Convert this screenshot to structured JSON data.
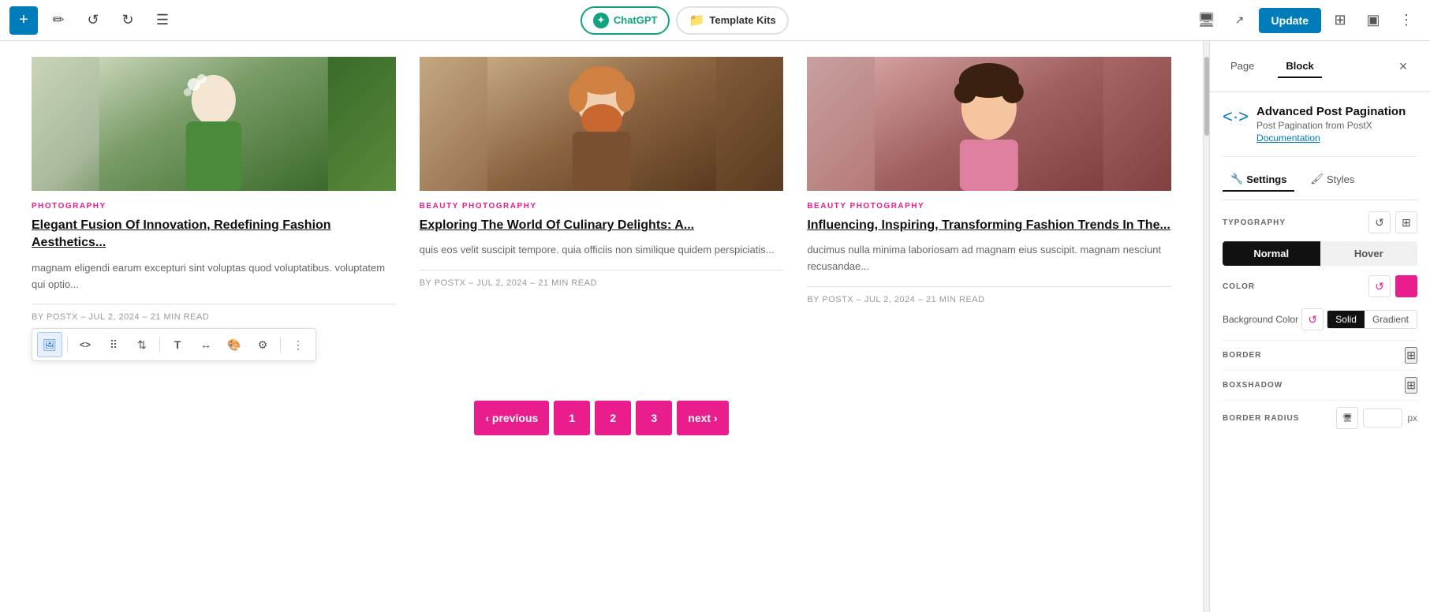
{
  "topbar": {
    "add_label": "+",
    "chatgpt_label": "ChatGPT",
    "template_kits_label": "Template Kits",
    "update_label": "Update"
  },
  "sidebar": {
    "page_tab": "Page",
    "block_tab": "Block",
    "close_label": "×",
    "block_info": {
      "title": "Advanced Post Pagination",
      "subtitle": "Post Pagination from PostX",
      "docs_link": "Documentation"
    },
    "settings_tab": "Settings",
    "styles_tab": "Styles",
    "typography_label": "TYPOGRAPHY",
    "normal_label": "Normal",
    "hover_label": "Hover",
    "color_label": "COLOR",
    "background_color_label": "Background Color",
    "solid_label": "Solid",
    "gradient_label": "Gradient",
    "border_label": "BORDER",
    "boxshadow_label": "BOXSHADOW",
    "border_radius_label": "BORDER RADIUS",
    "px_label": "px"
  },
  "cards": [
    {
      "category": "PHOTOGRAPHY",
      "title": "Elegant Fusion Of Innovation, Redefining Fashion Aesthetics...",
      "excerpt": "magnam eligendi earum excepturi sint voluptas quod voluptatibus. voluptatem qui optio...",
      "meta": "BY POSTX  –  JUL 2, 2024  –  21 MIN READ",
      "image_type": "woman"
    },
    {
      "category": "BEAUTY  PHOTOGRAPHY",
      "title": "Exploring The World Of Culinary Delights: A...",
      "excerpt": "quis eos velit suscipit tempore. quia officiis non similique quidem perspiciatis...",
      "meta": "BY POSTX  –  JUL 2, 2024  –  21 MIN READ",
      "image_type": "man"
    },
    {
      "category": "BEAUTY  PHOTOGRAPHY",
      "title": "Influencing, Inspiring, Transforming Fashion Trends In The...",
      "excerpt": "ducimus nulla minima laboriosam ad magnam eius suscipit. magnam nesciunt recusandae...",
      "meta": "BY POSTX  –  JUL 2, 2024  –  21 MIN READ",
      "image_type": "child"
    }
  ],
  "toolbar": {
    "image_icon": "🖼",
    "code_icon": "<>",
    "move_icon": "⠿",
    "arrows_icon": "⇅",
    "text_icon": "T",
    "width_icon": "↔",
    "paint_icon": "🎨",
    "settings_icon": "⚙",
    "more_icon": "⋮"
  },
  "pagination": {
    "prev_label": "‹ previous",
    "page1": "1",
    "page2": "2",
    "page3": "3",
    "next_label": "next ›"
  }
}
